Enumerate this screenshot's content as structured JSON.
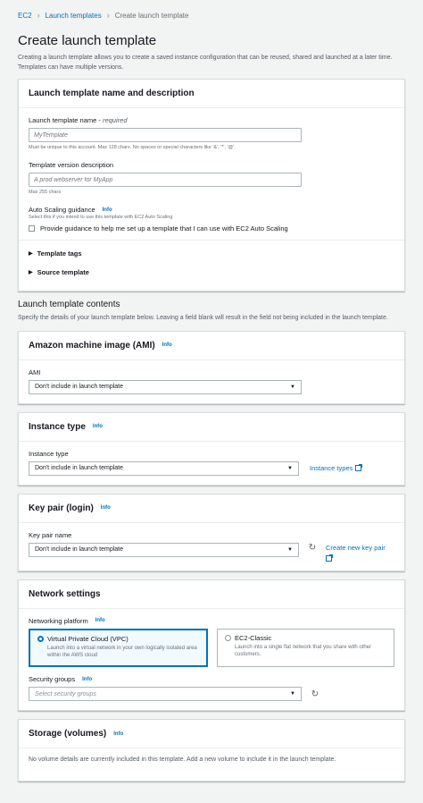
{
  "breadcrumb": {
    "items": [
      "EC2",
      "Launch templates",
      "Create launch template"
    ]
  },
  "page": {
    "title": "Create launch template",
    "description": "Creating a launch template allows you to create a saved instance configuration that can be reused, shared and launched at a later time. Templates can have multiple versions."
  },
  "name_panel": {
    "title": "Launch template name and description",
    "name_label": "Launch template name - ",
    "name_required": "required",
    "name_placeholder": "MyTemplate",
    "name_hint": "Must be unique to this account. Max 128 chars. No spaces or special characters like '&', '*', '@'.",
    "version_label": "Template version description",
    "version_placeholder": "A prod webserver for MyApp",
    "version_hint": "Max 255 chars",
    "asg_label": "Auto Scaling guidance",
    "asg_info": "Info",
    "asg_hint": "Select this if you intend to use this template with EC2 Auto Scaling",
    "asg_checkbox": "Provide guidance to help me set up a template that I can use with EC2 Auto Scaling",
    "tags_expander": "Template tags",
    "source_expander": "Source template"
  },
  "contents": {
    "title": "Launch template contents",
    "description": "Specify the details of your launch template below. Leaving a field blank will result in the field not being included in the launch template."
  },
  "ami_panel": {
    "title": "Amazon machine image (AMI)",
    "info": "Info",
    "label": "AMI",
    "value": "Don't include in launch template"
  },
  "instance_panel": {
    "title": "Instance type",
    "info": "Info",
    "label": "Instance type",
    "value": "Don't include in launch template",
    "link": "Instance types"
  },
  "keypair_panel": {
    "title": "Key pair (login)",
    "info": "Info",
    "label": "Key pair name",
    "value": "Don't include in launch template",
    "link": "Create new key pair"
  },
  "network_panel": {
    "title": "Network settings",
    "platform_label": "Networking platform",
    "platform_info": "Info",
    "vpc_title": "Virtual Private Cloud (VPC)",
    "vpc_desc": "Launch into a virtual network in your own logically isolated area within the AWS cloud",
    "classic_title": "EC2-Classic",
    "classic_desc": "Launch into a single flat network that you share with other customers.",
    "sg_label": "Security groups",
    "sg_info": "Info",
    "sg_placeholder": "Select security groups"
  },
  "storage_panel": {
    "title": "Storage (volumes)",
    "info": "Info",
    "note": "No volume details are currently included in this template. Add a new volume to include it in the launch template."
  },
  "colors": {
    "link": "#0073bb",
    "background": "#f2f3f3",
    "border": "#aab7b8"
  }
}
